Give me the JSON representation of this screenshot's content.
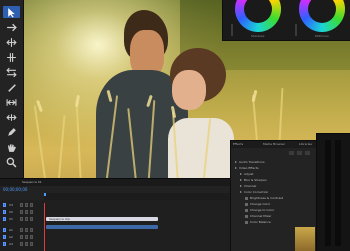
{
  "program_monitor": {
    "image": "couple-in-wheat-field"
  },
  "tools": [
    {
      "icon": "selection-arrow-icon"
    },
    {
      "icon": "track-select-icon"
    },
    {
      "icon": "ripple-edit-icon"
    },
    {
      "icon": "rolling-edit-icon"
    },
    {
      "icon": "rate-stretch-icon"
    },
    {
      "icon": "razor-icon"
    },
    {
      "icon": "slip-icon"
    },
    {
      "icon": "slide-icon"
    },
    {
      "icon": "pen-icon"
    },
    {
      "icon": "hand-icon"
    },
    {
      "icon": "zoom-icon"
    }
  ],
  "color_wheels": {
    "left_label": "Shadows",
    "right_label": "Midtones"
  },
  "timeline": {
    "tab": "Sequence 01",
    "timecode": "00;00;00;00",
    "clip_label": "Sequence clip",
    "tracks": [
      "V3",
      "V2",
      "V1",
      "A1",
      "A2",
      "A3"
    ]
  },
  "effects_panel": {
    "tabs": [
      "Effects",
      "Media Browser",
      "Libraries"
    ],
    "items": [
      {
        "label": "Audio Transitions",
        "level": 0,
        "type": "folder"
      },
      {
        "label": "Video Effects",
        "level": 0,
        "type": "folder-open"
      },
      {
        "label": "Adjust",
        "level": 1,
        "type": "folder"
      },
      {
        "label": "Blur & Sharpen",
        "level": 1,
        "type": "folder"
      },
      {
        "label": "Channel",
        "level": 1,
        "type": "folder"
      },
      {
        "label": "Color Correction",
        "level": 1,
        "type": "folder-open"
      },
      {
        "label": "Brightness & Contrast",
        "level": 2,
        "type": "effect"
      },
      {
        "label": "Change Color",
        "level": 2,
        "type": "effect"
      },
      {
        "label": "Change to Color",
        "level": 2,
        "type": "effect"
      },
      {
        "label": "Channel Mixer",
        "level": 2,
        "type": "effect"
      },
      {
        "label": "Color Balance",
        "level": 2,
        "type": "effect"
      }
    ]
  },
  "colors": {
    "accent_blue": "#2e6bd6",
    "timecode_blue": "#4a9cff",
    "playhead_red": "#e03b3b"
  }
}
